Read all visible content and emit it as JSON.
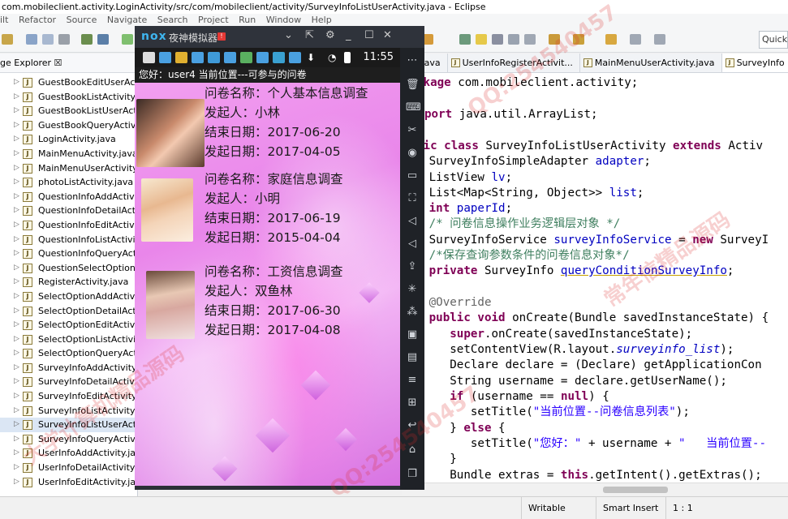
{
  "window": {
    "title": "com.mobileclient.activity.LoginActivity/src/com/mobileclient/activity/SurveyInfoListUserActivity.java - Eclipse"
  },
  "menubar": [
    "ilt",
    "Refactor",
    "Source",
    "Navigate",
    "Search",
    "Project",
    "Run",
    "Window",
    "Help"
  ],
  "quick_access": {
    "label": "Quick"
  },
  "package_explorer": {
    "tab_label": "ge Explorer ☒",
    "items": [
      {
        "name": "GuestBookEditUserActi"
      },
      {
        "name": "GuestBookListActivity.ja"
      },
      {
        "name": "GuestBookListUserActi"
      },
      {
        "name": "GuestBookQueryActivity"
      },
      {
        "name": "LoginActivity.java"
      },
      {
        "name": "MainMenuActivity.java"
      },
      {
        "name": "MainMenuUserActivity.j"
      },
      {
        "name": "photoListActivity.java"
      },
      {
        "name": "QuestionInfoAddActivit"
      },
      {
        "name": "QuestionInfoDetailActiv"
      },
      {
        "name": "QuestionInfoEditActivity"
      },
      {
        "name": "QuestionInfoListActivity"
      },
      {
        "name": "QuestionInfoQueryActiv"
      },
      {
        "name": "QuestionSelectOptionLi"
      },
      {
        "name": "RegisterActivity.java"
      },
      {
        "name": "SelectOptionAddActivity"
      },
      {
        "name": "SelectOptionDetailActiv"
      },
      {
        "name": "SelectOptionEditActivity"
      },
      {
        "name": "SelectOptionListActivity"
      },
      {
        "name": "SelectOptionQueryActiv"
      },
      {
        "name": "SurveyInfoAddActivity.ja"
      },
      {
        "name": "SurveyInfoDetailActivity"
      },
      {
        "name": "SurveyInfoEditActivity.ja"
      },
      {
        "name": "SurveyInfoListActivity.jav"
      },
      {
        "name": "SurveyInfoListUserActiv",
        "selected": true
      },
      {
        "name": "SurveyInfoQueryActivity"
      },
      {
        "name": "UserInfoAddActivity.java"
      },
      {
        "name": "UserInfoDetailActivity.ja"
      },
      {
        "name": "UserInfoEditActivity.java"
      }
    ]
  },
  "editor": {
    "tabs": [
      {
        "label": "l.java"
      },
      {
        "label": "UserInfoRegisterActivit..."
      },
      {
        "label": "MainMenuUserActivity.java"
      },
      {
        "label": "SurveyInfo",
        "active": true
      }
    ],
    "code": {
      "l1_kw": "ckage",
      "l1_rest": " com.mobileclient.activity;",
      "l2_kw": "port",
      "l2_rest": " java.util.ArrayList;",
      "l3_kw1": "lic class",
      "l3_mid": " SurveyInfoListUserActivity ",
      "l3_kw2": "extends",
      "l3_rest": " Activ",
      "l4_type": "   SurveyInfoSimpleAdapter ",
      "l4_fld": "adapter",
      "l4_end": ";",
      "l5_type": "   ListView ",
      "l5_fld": "lv",
      "l5_end": ";",
      "l6_type": "   List<Map<String, Object>> ",
      "l6_fld": "list",
      "l6_end": ";",
      "l7_kw": "   int",
      "l7_sp": " ",
      "l7_fld": "paperId",
      "l7_end": ";",
      "l8_cmt": "   /* 问卷信息操作业务逻辑层对象 */",
      "l9_type": "   SurveyInfoService ",
      "l9_fld": "surveyInfoService",
      "l9_mid": " = ",
      "l9_kw": "new",
      "l9_rest": " SurveyI",
      "l10_cmt": "   /*保存查询参数条件的问卷信息对象*/",
      "l11_kw": "   private",
      "l11_type": " SurveyInfo ",
      "l11_fld": "queryConditionSurveyInfo",
      "l11_end": ";",
      "l12_ann": "   @Override",
      "l13_kw": "   public void",
      "l13_rest": " onCreate(Bundle savedInstanceState) {",
      "l14_kw": "      super",
      "l14_rest": ".onCreate(savedInstanceState);",
      "l15_a": "      setContentView(R.layout.",
      "l15_ital": "surveyinfo_list",
      "l15_b": ");",
      "l16": "      Declare declare = (Declare) getApplicationCon",
      "l17": "      String username = declare.getUserName();",
      "l18_kw": "      if",
      "l18_mid": " (username == ",
      "l18_kw2": "null",
      "l18_end": ") {",
      "l19_a": "         setTitle(",
      "l19_str": "\"当前位置--问卷信息列表\"",
      "l19_b": ");",
      "l20_a": "      } ",
      "l20_kw": "else",
      "l20_b": " {",
      "l21_a": "         setTitle(",
      "l21_str": "\"您好：\"",
      "l21_b": " + username + ",
      "l21_str2": "\"   当前位置--",
      "l22": "      }",
      "l23_a": "      Bundle extras = ",
      "l23_kw": "this",
      "l23_b": ".getIntent().getExtras();"
    }
  },
  "statusbar": {
    "writable": "Writable",
    "insert_mode": "Smart Insert",
    "position": "1 : 1"
  },
  "nox": {
    "logo": "nox",
    "name": "夜神模拟器",
    "badge": "!"
  },
  "android": {
    "time": "11:55",
    "title": "您好：user4  当前位置---可参与的问卷",
    "surveys": [
      {
        "name_label": "问卷名称：个人基本信息调查",
        "initiator": "发起人：小林",
        "end_date": "结束日期：2017-06-20",
        "start_date": "发起日期：2017-04-05"
      },
      {
        "name_label": "问卷名称：家庭信息调查",
        "initiator": "发起人：小明",
        "end_date": "结束日期：2017-06-19",
        "start_date": "发起日期：2015-04-04"
      },
      {
        "name_label": "问卷名称：工资信息调查",
        "initiator": "发起人：双鱼林",
        "end_date": "结束日期：2017-06-30",
        "start_date": "发起日期：2017-04-08"
      }
    ]
  },
  "watermarks": [
    "QQ:254540457",
    "常年信精品源码",
    "QQ:254540457",
    "大学计算机精品源码"
  ],
  "colors": {
    "accent_nox": "#3fb6f0",
    "keyword": "#7f0055",
    "field": "#0000c0",
    "comment": "#3f7f5f",
    "string": "#2a00ff"
  }
}
